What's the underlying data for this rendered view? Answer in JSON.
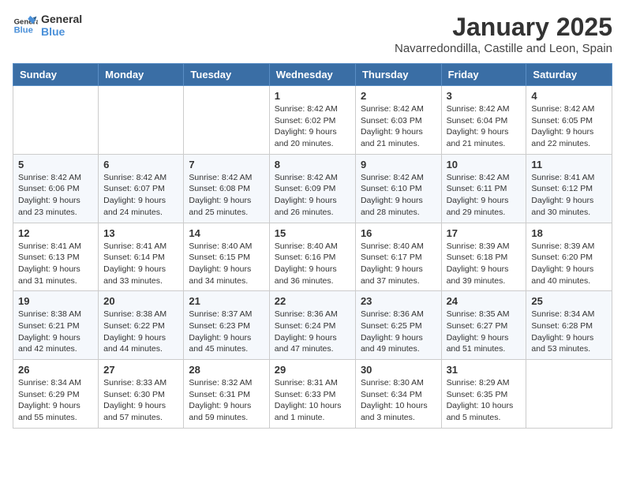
{
  "logo": {
    "line1": "General",
    "line2": "Blue"
  },
  "title": "January 2025",
  "subtitle": "Navarredondilla, Castille and Leon, Spain",
  "weekdays": [
    "Sunday",
    "Monday",
    "Tuesday",
    "Wednesday",
    "Thursday",
    "Friday",
    "Saturday"
  ],
  "weeks": [
    [
      {
        "day": "",
        "content": ""
      },
      {
        "day": "",
        "content": ""
      },
      {
        "day": "",
        "content": ""
      },
      {
        "day": "1",
        "content": "Sunrise: 8:42 AM\nSunset: 6:02 PM\nDaylight: 9 hours\nand 20 minutes."
      },
      {
        "day": "2",
        "content": "Sunrise: 8:42 AM\nSunset: 6:03 PM\nDaylight: 9 hours\nand 21 minutes."
      },
      {
        "day": "3",
        "content": "Sunrise: 8:42 AM\nSunset: 6:04 PM\nDaylight: 9 hours\nand 21 minutes."
      },
      {
        "day": "4",
        "content": "Sunrise: 8:42 AM\nSunset: 6:05 PM\nDaylight: 9 hours\nand 22 minutes."
      }
    ],
    [
      {
        "day": "5",
        "content": "Sunrise: 8:42 AM\nSunset: 6:06 PM\nDaylight: 9 hours\nand 23 minutes."
      },
      {
        "day": "6",
        "content": "Sunrise: 8:42 AM\nSunset: 6:07 PM\nDaylight: 9 hours\nand 24 minutes."
      },
      {
        "day": "7",
        "content": "Sunrise: 8:42 AM\nSunset: 6:08 PM\nDaylight: 9 hours\nand 25 minutes."
      },
      {
        "day": "8",
        "content": "Sunrise: 8:42 AM\nSunset: 6:09 PM\nDaylight: 9 hours\nand 26 minutes."
      },
      {
        "day": "9",
        "content": "Sunrise: 8:42 AM\nSunset: 6:10 PM\nDaylight: 9 hours\nand 28 minutes."
      },
      {
        "day": "10",
        "content": "Sunrise: 8:42 AM\nSunset: 6:11 PM\nDaylight: 9 hours\nand 29 minutes."
      },
      {
        "day": "11",
        "content": "Sunrise: 8:41 AM\nSunset: 6:12 PM\nDaylight: 9 hours\nand 30 minutes."
      }
    ],
    [
      {
        "day": "12",
        "content": "Sunrise: 8:41 AM\nSunset: 6:13 PM\nDaylight: 9 hours\nand 31 minutes."
      },
      {
        "day": "13",
        "content": "Sunrise: 8:41 AM\nSunset: 6:14 PM\nDaylight: 9 hours\nand 33 minutes."
      },
      {
        "day": "14",
        "content": "Sunrise: 8:40 AM\nSunset: 6:15 PM\nDaylight: 9 hours\nand 34 minutes."
      },
      {
        "day": "15",
        "content": "Sunrise: 8:40 AM\nSunset: 6:16 PM\nDaylight: 9 hours\nand 36 minutes."
      },
      {
        "day": "16",
        "content": "Sunrise: 8:40 AM\nSunset: 6:17 PM\nDaylight: 9 hours\nand 37 minutes."
      },
      {
        "day": "17",
        "content": "Sunrise: 8:39 AM\nSunset: 6:18 PM\nDaylight: 9 hours\nand 39 minutes."
      },
      {
        "day": "18",
        "content": "Sunrise: 8:39 AM\nSunset: 6:20 PM\nDaylight: 9 hours\nand 40 minutes."
      }
    ],
    [
      {
        "day": "19",
        "content": "Sunrise: 8:38 AM\nSunset: 6:21 PM\nDaylight: 9 hours\nand 42 minutes."
      },
      {
        "day": "20",
        "content": "Sunrise: 8:38 AM\nSunset: 6:22 PM\nDaylight: 9 hours\nand 44 minutes."
      },
      {
        "day": "21",
        "content": "Sunrise: 8:37 AM\nSunset: 6:23 PM\nDaylight: 9 hours\nand 45 minutes."
      },
      {
        "day": "22",
        "content": "Sunrise: 8:36 AM\nSunset: 6:24 PM\nDaylight: 9 hours\nand 47 minutes."
      },
      {
        "day": "23",
        "content": "Sunrise: 8:36 AM\nSunset: 6:25 PM\nDaylight: 9 hours\nand 49 minutes."
      },
      {
        "day": "24",
        "content": "Sunrise: 8:35 AM\nSunset: 6:27 PM\nDaylight: 9 hours\nand 51 minutes."
      },
      {
        "day": "25",
        "content": "Sunrise: 8:34 AM\nSunset: 6:28 PM\nDaylight: 9 hours\nand 53 minutes."
      }
    ],
    [
      {
        "day": "26",
        "content": "Sunrise: 8:34 AM\nSunset: 6:29 PM\nDaylight: 9 hours\nand 55 minutes."
      },
      {
        "day": "27",
        "content": "Sunrise: 8:33 AM\nSunset: 6:30 PM\nDaylight: 9 hours\nand 57 minutes."
      },
      {
        "day": "28",
        "content": "Sunrise: 8:32 AM\nSunset: 6:31 PM\nDaylight: 9 hours\nand 59 minutes."
      },
      {
        "day": "29",
        "content": "Sunrise: 8:31 AM\nSunset: 6:33 PM\nDaylight: 10 hours\nand 1 minute."
      },
      {
        "day": "30",
        "content": "Sunrise: 8:30 AM\nSunset: 6:34 PM\nDaylight: 10 hours\nand 3 minutes."
      },
      {
        "day": "31",
        "content": "Sunrise: 8:29 AM\nSunset: 6:35 PM\nDaylight: 10 hours\nand 5 minutes."
      },
      {
        "day": "",
        "content": ""
      }
    ]
  ]
}
